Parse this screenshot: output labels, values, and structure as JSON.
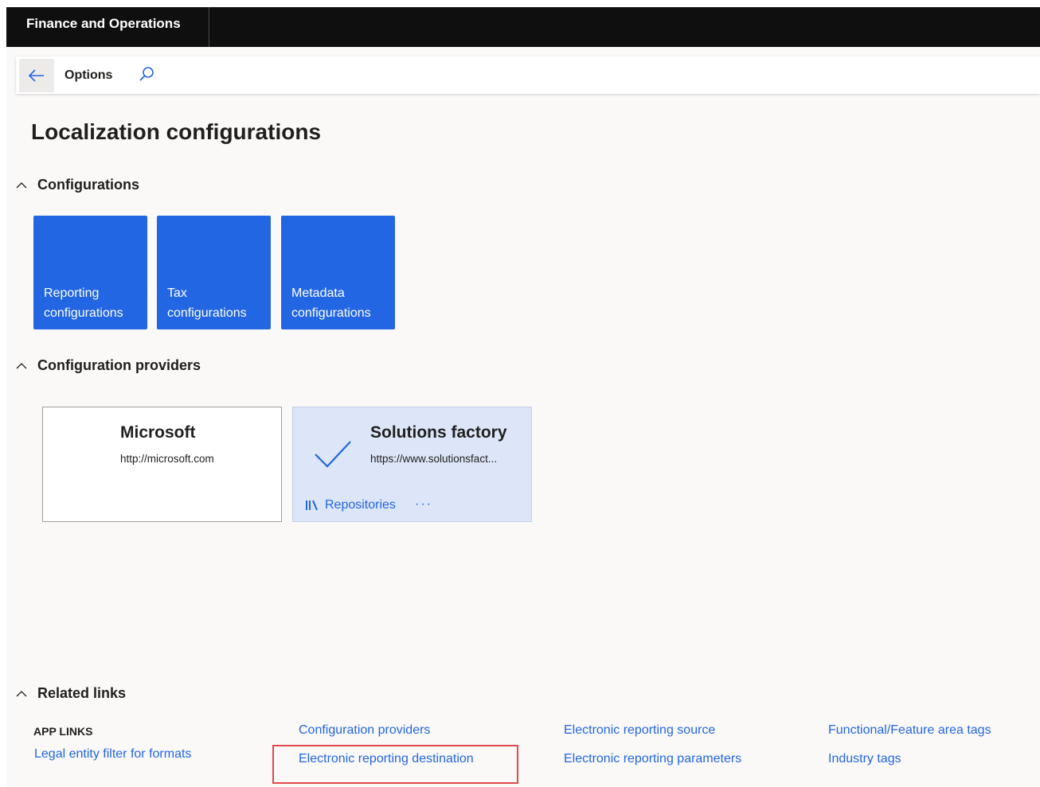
{
  "app": {
    "title": "Finance and Operations"
  },
  "actionbar": {
    "back_icon": "back-arrow-icon",
    "options_label": "Options",
    "search_icon": "search-icon"
  },
  "page": {
    "title": "Localization configurations"
  },
  "sections": {
    "configurations": {
      "title": "Configurations"
    },
    "providers": {
      "title": "Configuration providers"
    },
    "related": {
      "title": "Related links"
    }
  },
  "tiles": [
    {
      "label": "Reporting configurations"
    },
    {
      "label": "Tax configurations"
    },
    {
      "label": "Metadata configurations"
    }
  ],
  "providers": [
    {
      "name": "Microsoft",
      "url": "http://microsoft.com",
      "active": false
    },
    {
      "name": "Solutions factory",
      "url": "https://www.solutionsfact...",
      "active": true,
      "repositories_label": "Repositories",
      "more_label": "···"
    }
  ],
  "related_links": {
    "app_links_header": "APP LINKS",
    "legal_entity_filter": "Legal entity filter for formats",
    "configuration_providers": "Configuration providers",
    "er_destination": "Electronic reporting destination",
    "er_source": "Electronic reporting source",
    "er_parameters": "Electronic reporting parameters",
    "functional_tags": "Functional/Feature area tags",
    "industry_tags": "Industry tags"
  },
  "colors": {
    "accent": "#2266e3",
    "topbar": "#0f0f0f",
    "highlight": "#e0484f",
    "selected_card": "#dce6f8"
  }
}
